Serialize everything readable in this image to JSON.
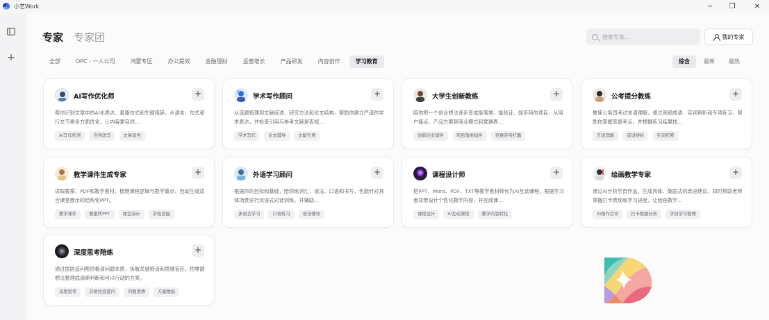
{
  "app": {
    "title": "小艺Work"
  },
  "header": {
    "tabs": [
      {
        "label": "专家",
        "active": true
      },
      {
        "label": "专家团",
        "active": false
      }
    ],
    "search_placeholder": "搜索专家…",
    "my_experts_label": "我的专家"
  },
  "categories": [
    {
      "label": "全部",
      "active": false
    },
    {
      "label": "OPC - 一人公司",
      "active": false
    },
    {
      "label": "鸿蒙专区",
      "active": false
    },
    {
      "label": "办公提效",
      "active": false
    },
    {
      "label": "金融理财",
      "active": false
    },
    {
      "label": "运营增长",
      "active": false
    },
    {
      "label": "产品研发",
      "active": false
    },
    {
      "label": "内容创作",
      "active": false
    },
    {
      "label": "学习教育",
      "active": true
    }
  ],
  "sort": [
    {
      "label": "综合",
      "active": true
    },
    {
      "label": "最新",
      "active": false
    },
    {
      "label": "最热",
      "active": false
    }
  ],
  "cards": [
    {
      "title": "AI写作优化师",
      "desc": "帮你识别文章中的AI化表达、套路句式和生硬措辞，从语言、句式和行文节奏多方面优化，让内容更自然…",
      "tags": [
        "AI写作检测",
        "自然改写",
        "文章润色"
      ],
      "avatar_icon": "ai-writer-avatar",
      "add_label": "+"
    },
    {
      "title": "学术写作顾问",
      "desc": "从选题梳理到文献综述、研究方法和论文结构，帮助你建立严谨的学术表达，并检查引用与参考文献是否规…",
      "tags": [
        "学术写作",
        "论文辅导",
        "文献引用"
      ],
      "avatar_icon": "academic-avatar",
      "add_label": "+"
    },
    {
      "title": "大学生创新教练",
      "desc": "陪你把一个创业想法逐步变成能落地、能验证、能答辩的项目，从用户痛点、产品方案到商业模式和竞赛表…",
      "tags": [
        "创新创业辅导",
        "项目落地指导",
        "竞赛答辩打磨"
      ],
      "avatar_icon": "innovation-coach-avatar",
      "add_label": "+"
    },
    {
      "title": "公考提分教练",
      "desc": "聚焦公务员考试言语理解，通过高频成语、实词辨析和专项练习，帮助你掌握答题考点，并根据练习结果找…",
      "tags": [
        "言语理解",
        "成语辨析",
        "实词积累"
      ],
      "avatar_icon": "exam-coach-avatar",
      "add_label": "+"
    },
    {
      "title": "教学课件生成专家",
      "desc": "读取教案、PDF和教学素材，梳理课程逻辑与教学重点，自动生成适合课堂展示的结构化PPT。",
      "tags": [
        "教学课件",
        "教案转PPT",
        "课堂演示",
        "学段适配"
      ],
      "avatar_icon": "courseware-avatar",
      "add_label": "+"
    },
    {
      "title": "外语学习顾问",
      "desc": "根据你的目标和基础，陪你练词汇、语法、口语和书写，也能针对具体场景进行沉浸式对话训练，并辅助…",
      "tags": [
        "多语言学习",
        "口语练习",
        "语法辅导"
      ],
      "avatar_icon": "language-avatar",
      "add_label": "+"
    },
    {
      "title": "课程设计师",
      "desc": "把PPT、Word、PDF、TXT等教学素材转化为AI互动课程，根据学习者背景设计个性化教学内容，并完成课…",
      "tags": [
        "课程设计",
        "AI互动课程",
        "教学内容转化"
      ],
      "avatar_icon": "course-designer-avatar",
      "add_label": "+"
    },
    {
      "title": "绘画教学专家",
      "desc": "通过AI分析学员作品，生成具体、鼓励式的改进建议，同时帮助老师掌握打卡表现和学习进度，让绘画教学…",
      "tags": [
        "AI画作点评",
        "打卡数据分析",
        "学员学习管理"
      ],
      "avatar_icon": "painting-avatar",
      "add_label": "+"
    },
    {
      "title": "深度思考陪练",
      "desc": "通过层层追问帮你看清问题本质，拆解关键假设和思维盲区，把零散想法整理成清晰判断和可以行动的方案。",
      "tags": [
        "深度思考",
        "苏格拉底提问",
        "问题澄清",
        "方案推敲"
      ],
      "avatar_icon": "deep-thinking-avatar",
      "add_label": "+"
    }
  ],
  "colors": {
    "accent_bg": "#e9e9ed",
    "card_bg": "#ffffff",
    "page_bg": "#fbfbfc"
  }
}
